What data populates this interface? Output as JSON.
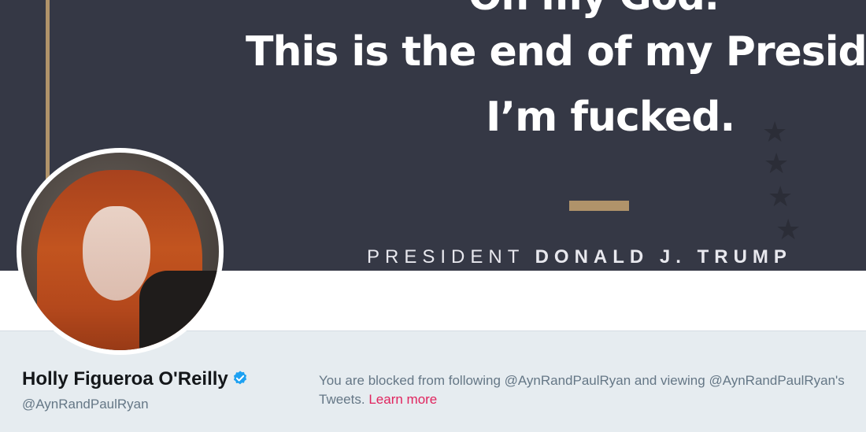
{
  "banner": {
    "quote_line1": "Oh my God.",
    "quote_line2": "This is the end of my Preside",
    "quote_line3": "I’m fucked.",
    "attribution_prefix": "PRESIDENT",
    "attribution_name": "DONALD J. TRUMP"
  },
  "profile": {
    "display_name": "Holly Figueroa O'Reilly",
    "handle": "@AynRandPaulRyan",
    "verified": true
  },
  "notice": {
    "blocked_text": "You are blocked from following @AynRandPaulRyan and viewing @AynRandPaulRyan's Tweets.",
    "learn_more": "Learn more"
  },
  "colors": {
    "banner_bg": "#353845",
    "gold": "#b0936a",
    "page_bg": "#e6ecf0",
    "link": "#e0245e",
    "verified_blue": "#1da1f2"
  }
}
